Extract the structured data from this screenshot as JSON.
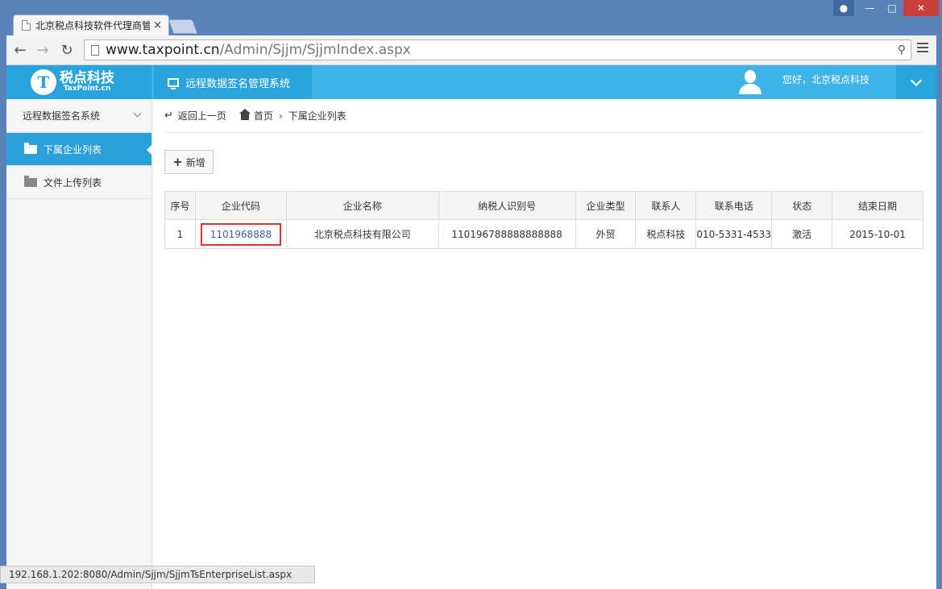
{
  "browser": {
    "tab_title": "北京税点科技软件代理商管",
    "tab_close": "×",
    "url_host": "www.taxpoint.cn",
    "url_path": "/Admin/Sjjm/SjjmIndex.aspx",
    "status_url": "192.168.1.202:8080/Admin/Sjjm/SjjmTsEnterpriseList.aspx"
  },
  "header": {
    "logo_mark": "T",
    "logo_cn": "税点科技",
    "logo_en": "TaxPoint.cn",
    "system_name": "远程数据签名管理系统",
    "greeting": "您好，北京税点科技"
  },
  "sidebar": {
    "group_label": "远程数据签名系统",
    "items": [
      {
        "label": "下属企业列表",
        "active": true
      },
      {
        "label": "文件上传列表",
        "active": false
      }
    ]
  },
  "breadcrumb": {
    "back": "返回上一页",
    "home": "首页",
    "current": "下属企业列表"
  },
  "actions": {
    "add": "新增"
  },
  "table": {
    "columns": [
      "序号",
      "企业代码",
      "企业名称",
      "纳税人识别号",
      "企业类型",
      "联系人",
      "联系电话",
      "状态",
      "结束日期"
    ],
    "rows": [
      [
        "1",
        "1101968888",
        "北京税点科技有限公司",
        "110196788888888888",
        "外贸",
        "税点科技",
        "010-5331-4533",
        "激活",
        "2015-10-01"
      ]
    ]
  },
  "colors": {
    "accent": "#3db3e8",
    "accent_dark": "#29a3dc",
    "highlight": "#e03030"
  }
}
